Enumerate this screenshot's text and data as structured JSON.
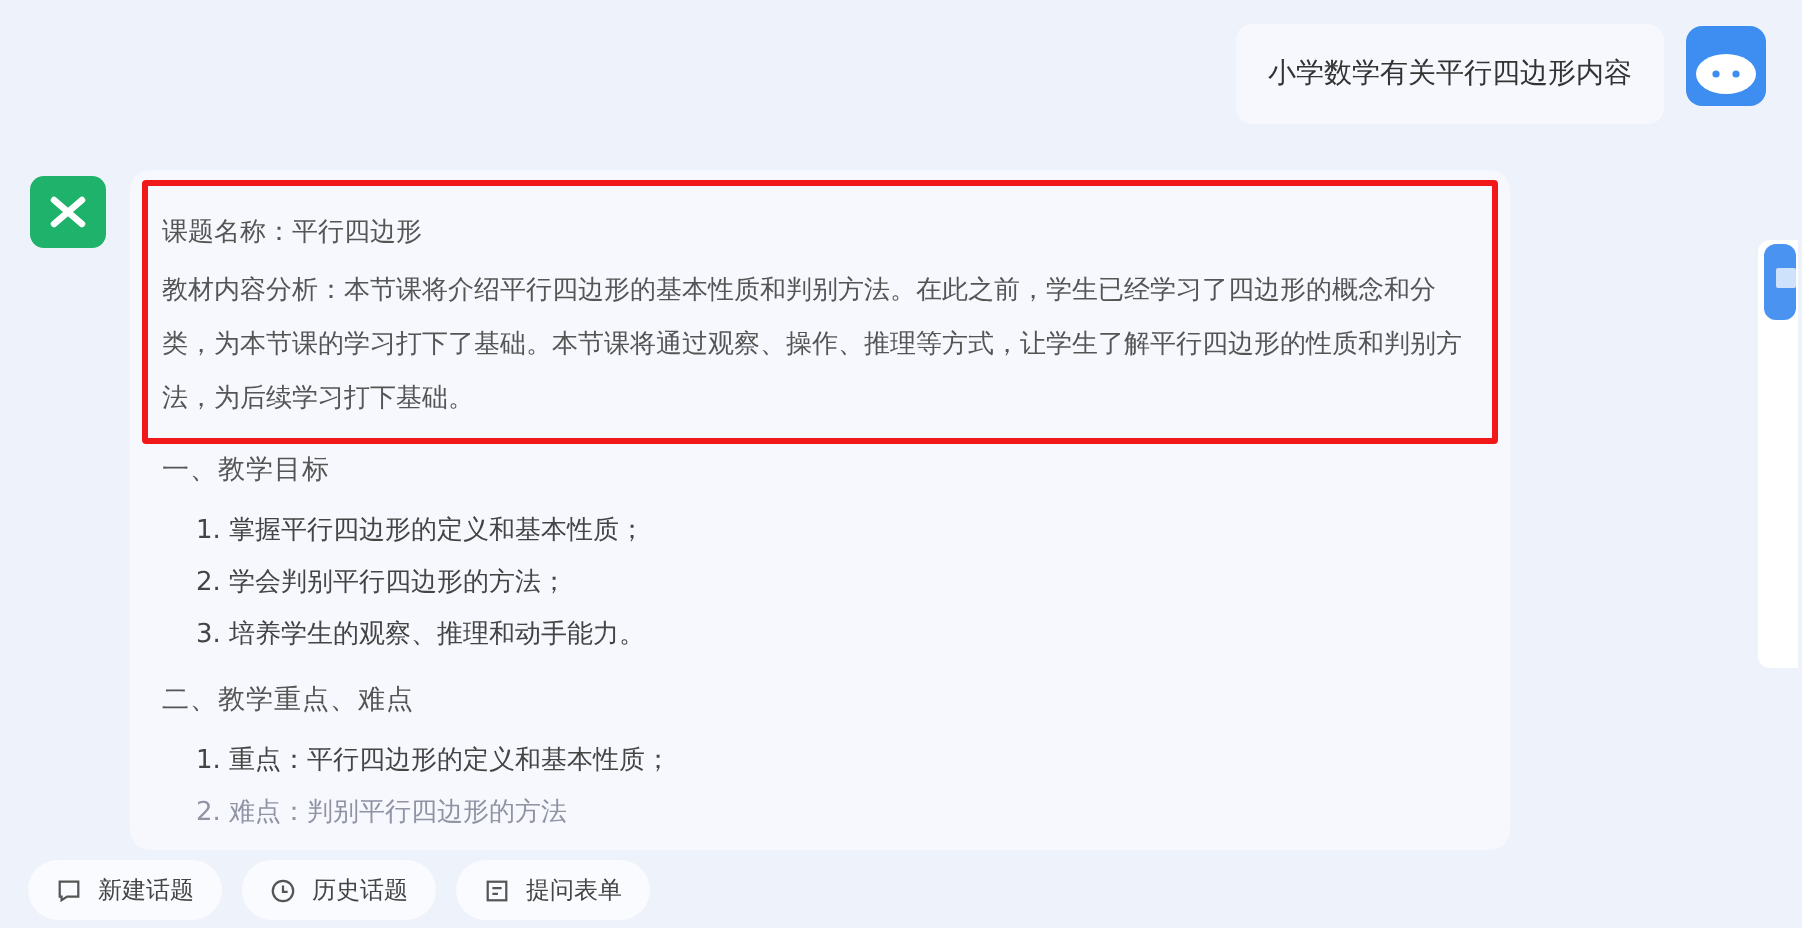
{
  "user_message": {
    "text": "小学数学有关平行四边形内容"
  },
  "answer": {
    "highlighted": [
      {
        "kind": "title",
        "text": "课题名称：平行四边形"
      },
      {
        "kind": "paragraph",
        "text": "教材内容分析：本节课将介绍平行四边形的基本性质和判别方法。在此之前，学生已经学习了四边形的概念和分类，为本节课的学习打下了基础。本节课将通过观察、操作、推理等方式，让学生了解平行四边形的性质和判别方法，为后续学习打下基础。"
      }
    ],
    "sections": [
      {
        "heading": "一、教学目标",
        "items": [
          {
            "text": "1. 掌握平行四边形的定义和基本性质；",
            "faded": false
          },
          {
            "text": "2. 学会判别平行四边形的方法；",
            "faded": false
          },
          {
            "text": "3. 培养学生的观察、推理和动手能力。",
            "faded": false
          }
        ]
      },
      {
        "heading": "二、教学重点、难点",
        "items": [
          {
            "text": "1. 重点：平行四边形的定义和基本性质；",
            "faded": false
          },
          {
            "text": "2. 难点：判别平行四边形的方法",
            "faded": true
          }
        ]
      }
    ]
  },
  "actions": [
    {
      "kind": "chat",
      "label": "新建话题"
    },
    {
      "kind": "clock",
      "label": "历史话题"
    },
    {
      "kind": "form",
      "label": "提问表单"
    }
  ]
}
